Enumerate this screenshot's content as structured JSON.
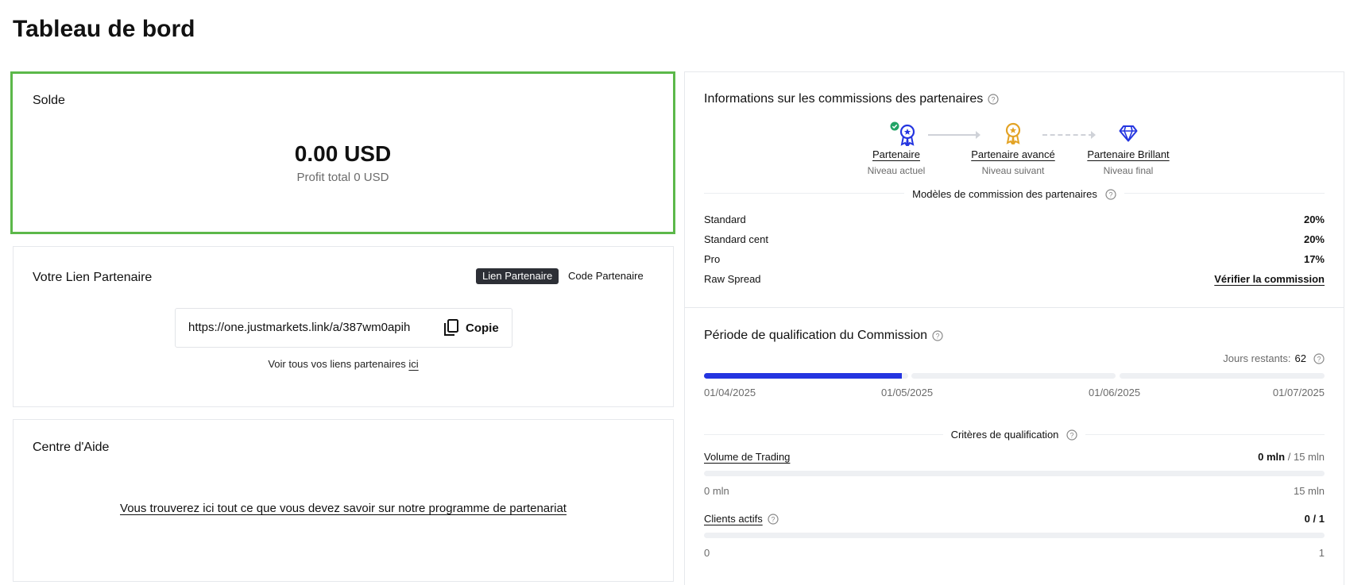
{
  "page": {
    "title": "Tableau de bord"
  },
  "balance": {
    "title": "Solde",
    "amount": "0.00 USD",
    "profit": "Profit total 0 USD",
    "highlight_color": "#5cb84a"
  },
  "partner_link": {
    "title": "Votre Lien Partenaire",
    "toggle": {
      "active": "Lien Partenaire",
      "inactive": "Code Partenaire"
    },
    "url": "https://one.justmarkets.link/a/387wm0apih",
    "copy_label": "Copie",
    "see_all_text": "Voir tous vos liens partenaires",
    "see_all_link": "ici"
  },
  "help_center": {
    "title": "Centre d'Aide",
    "link": "Vous trouverez ici tout ce que vous devez savoir sur notre programme de partenariat"
  },
  "commission": {
    "title": "Informations sur les commissions des partenaires",
    "levels": [
      {
        "name": "Partenaire",
        "status": "Niveau actuel",
        "icon": "ribbon-medal-icon",
        "color": "#2435e0"
      },
      {
        "name": "Partenaire avancé",
        "status": "Niveau suivant",
        "icon": "gold-medal-icon",
        "color": "#e3a325"
      },
      {
        "name": "Partenaire Brillant",
        "status": "Niveau final",
        "icon": "diamond-icon",
        "color": "#2435e0"
      }
    ],
    "models_title": "Modèles de commission des partenaires",
    "models": [
      {
        "label": "Standard",
        "value": "20%"
      },
      {
        "label": "Standard cent",
        "value": "20%"
      },
      {
        "label": "Pro",
        "value": "17%"
      },
      {
        "label": "Raw Spread",
        "value": "Vérifier la commission"
      }
    ]
  },
  "qualification": {
    "title": "Période de qualification du Commission",
    "days_label": "Jours restants:",
    "days_value": "62",
    "dates": [
      "01/04/2025",
      "01/05/2025",
      "01/06/2025",
      "01/07/2025"
    ],
    "period_progress_fraction_of_first_month": 0.97,
    "progress_color": "#2435e0",
    "criteria_title": "Critères de qualification",
    "criteria": [
      {
        "label": "Volume de Trading",
        "current": "0 mln",
        "target": "/ 15 mln",
        "min": "0 mln",
        "max": "15 mln",
        "progress": 0
      },
      {
        "label": "Clients actifs",
        "current": "0",
        "target": "/ 1",
        "min": "0",
        "max": "1",
        "progress": 0
      }
    ]
  }
}
